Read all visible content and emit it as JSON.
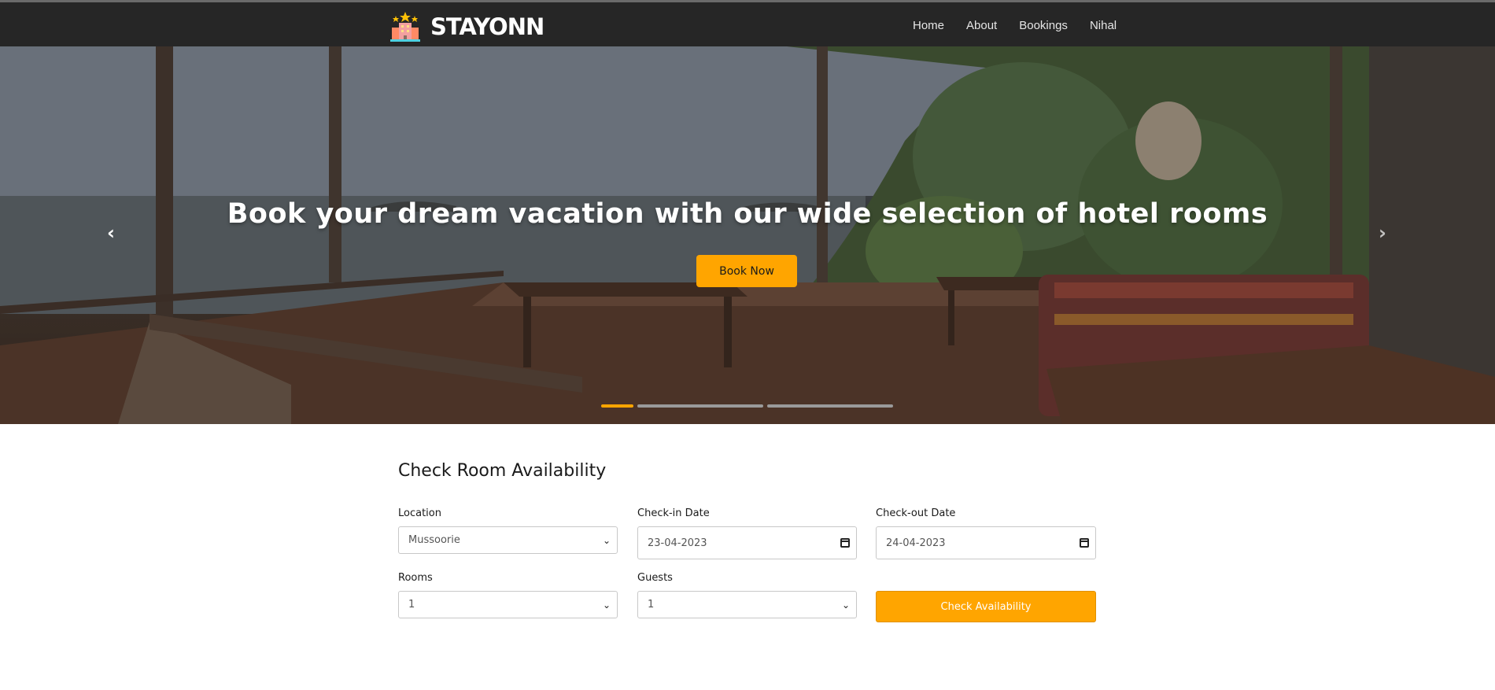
{
  "navbar": {
    "brand": "STAYONN",
    "links": [
      "Home",
      "About",
      "Bookings",
      "Nihal"
    ]
  },
  "hero": {
    "title": "Book your dream vacation with our wide selection of hotel rooms",
    "button": "Book Now",
    "prev_icon": "chevron-left-icon",
    "next_icon": "chevron-right-icon",
    "slides": 3,
    "active_slide": 1
  },
  "form": {
    "title": "Check Room Availability",
    "location_label": "Location",
    "location_value": "Mussoorie",
    "checkin_label": "Check-in Date",
    "checkin_value": "23-04-2023",
    "checkout_label": "Check-out Date",
    "checkout_value": "24-04-2023",
    "rooms_label": "Rooms",
    "rooms_value": "1",
    "guests_label": "Guests",
    "guests_value": "1",
    "submit": "Check Availability"
  },
  "colors": {
    "accent": "#ffa500",
    "navbar": "#262626"
  }
}
